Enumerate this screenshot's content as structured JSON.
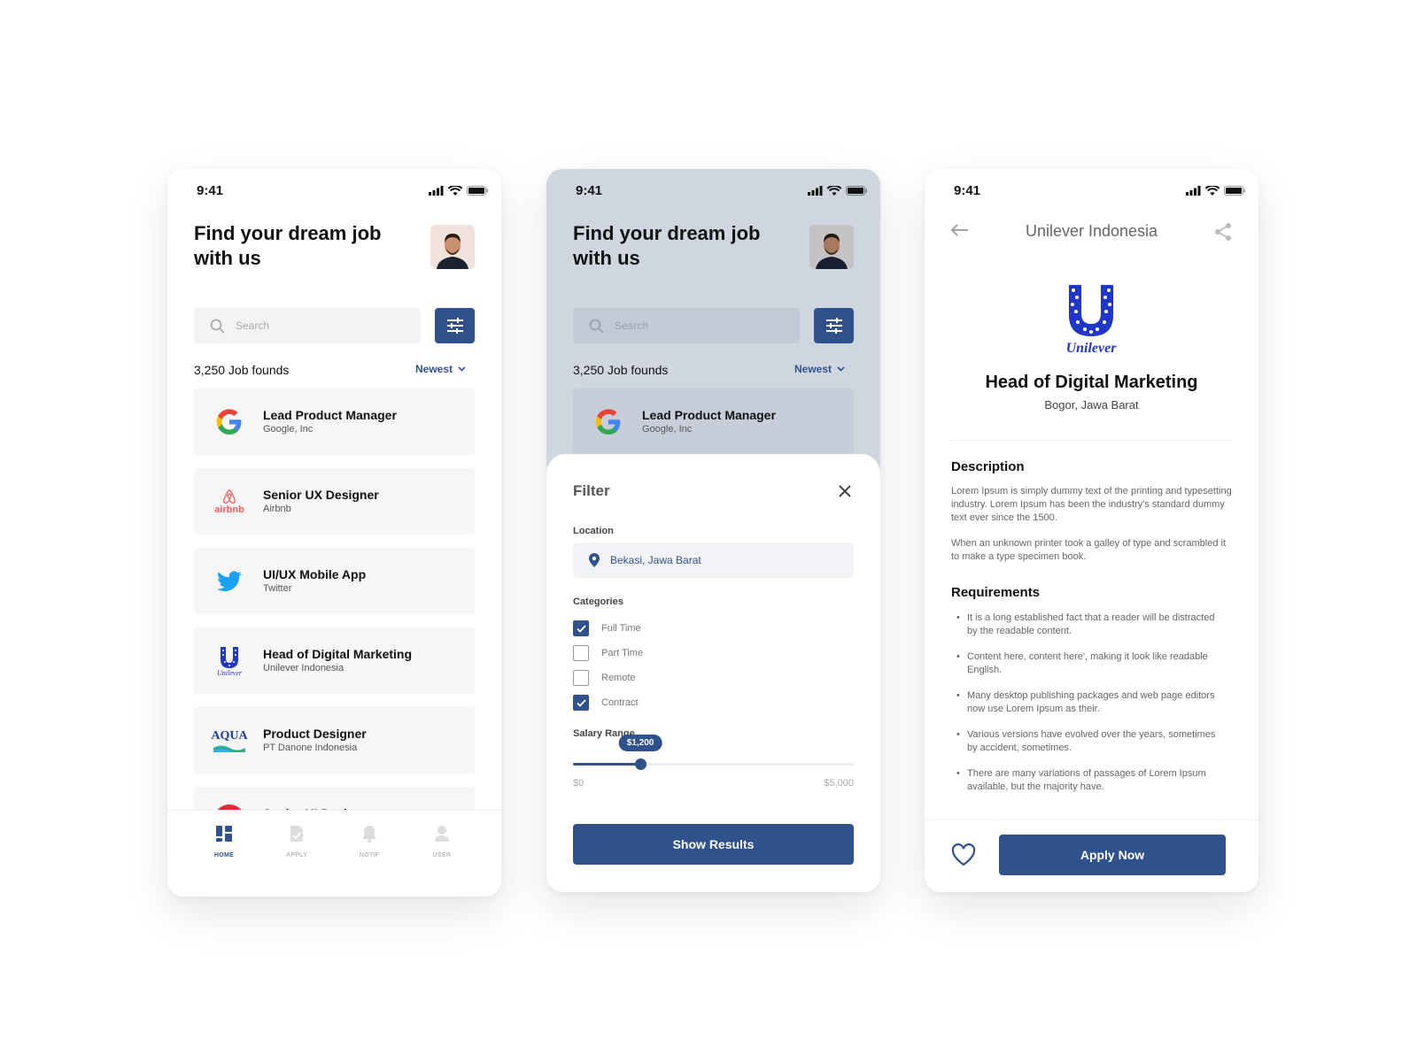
{
  "status": {
    "time": "9:41"
  },
  "home": {
    "title_line1": "Find your dream job",
    "title_line2": "with us",
    "search_placeholder": "Search",
    "found": "3,250 Job founds",
    "sort": "Newest",
    "jobs": [
      {
        "title": "Lead Product Manager",
        "company": "Google, Inc",
        "logo": "google-logo"
      },
      {
        "title": "Senior UX Designer",
        "company": "Airbnb",
        "logo": "airbnb-logo",
        "logo_text": "airbnb"
      },
      {
        "title": "UI/UX Mobile App",
        "company": "Twitter",
        "logo": "twitter-logo"
      },
      {
        "title": "Head of Digital Marketing",
        "company": "Unilever Indonesia",
        "logo": "unilever-logo",
        "logo_text": "Unilever"
      },
      {
        "title": "Product Designer",
        "company": "PT Danone Indonesia",
        "logo": "aqua-logo",
        "logo_text": "AQUA"
      },
      {
        "title": "Senior UI Designer",
        "company": "",
        "logo": "pepsi-logo"
      }
    ],
    "tabs": [
      {
        "label": "HOME",
        "icon": "home-icon"
      },
      {
        "label": "APPLY",
        "icon": "apply-icon"
      },
      {
        "label": "NOTIF",
        "icon": "bell-icon"
      },
      {
        "label": "USER",
        "icon": "user-icon"
      }
    ]
  },
  "filter": {
    "title": "Filter",
    "location_label": "Location",
    "location_value": "Bekasi, Jawa Barat",
    "categories_label": "Categories",
    "categories": [
      {
        "label": "Full Time",
        "checked": true
      },
      {
        "label": "Part Time",
        "checked": false
      },
      {
        "label": "Remote",
        "checked": false
      },
      {
        "label": "Contract",
        "checked": true
      }
    ],
    "salary_label": "Salary Range",
    "salary_value": "$1,200",
    "salary_min": "$0",
    "salary_max": "$5,000",
    "salary_fraction": 0.24,
    "button": "Show Results"
  },
  "detail": {
    "header": "Unilever Indonesia",
    "logo_text": "Unilever",
    "title": "Head of Digital Marketing",
    "location": "Bogor, Jawa Barat",
    "description_heading": "Description",
    "description_p1": "Lorem Ipsum is simply dummy text of the printing and typesetting industry. Lorem Ipsum has been the industry's standard dummy text ever since the 1500.",
    "description_p2": "When an unknown printer took a galley of type and scrambled it to make a type specimen book.",
    "requirements_heading": "Requirements",
    "requirements": [
      "It is a long established fact that a reader will be distracted by the readable content.",
      "Content here, content here', making it look like readable English.",
      "Many desktop publishing packages and web page editors now use Lorem Ipsum as their.",
      "Various versions have evolved over the years, sometimes by accident, sometimes.",
      "There are many variations of passages of Lorem Ipsum available, but the majority have."
    ],
    "button": "Apply Now"
  },
  "colors": {
    "primary": "#2f528d",
    "overlay": "#d0d6e0"
  }
}
